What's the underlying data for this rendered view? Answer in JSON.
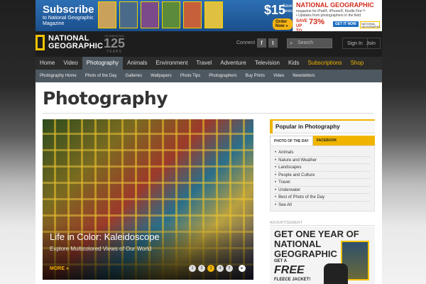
{
  "ad_left": {
    "title": "Subscribe",
    "text": "to National Geographic Magazine",
    "price": "$15",
    "price_note": "Save 79% off the newsstand price.",
    "button": "Order Now »",
    "cover_colors": [
      "#c9a15a",
      "#4a6a8a",
      "#7a4a8a",
      "#5a8a3a",
      "#c5603a",
      "#e0c040"
    ]
  },
  "ad_right": {
    "title": "NATIONAL GEOGRAPHIC",
    "line1": "magazine for iPad®, iPhone®, Kindle Fire™",
    "line2": "• Updates from photographers in the field",
    "save_label": "SAVE UP TO",
    "save_pct": "73%",
    "button": "GET IT NOW",
    "mini_logo": "NATIONAL GEOGRAPHIC"
  },
  "header": {
    "logo_line1": "NATIONAL",
    "logo_line2": "GEOGRAPHIC",
    "anniv_top": "CELEBRATING",
    "anniv_num": "125",
    "anniv_bottom": "YEARS",
    "connect": "Connect",
    "facebook": "f",
    "twitter": "t",
    "search_placeholder": "Search",
    "sign_in": "Sign In",
    "join": "Join"
  },
  "nav": [
    {
      "label": "Home",
      "key": "home"
    },
    {
      "label": "Video",
      "key": "video"
    },
    {
      "label": "Photography",
      "key": "photography",
      "active": true
    },
    {
      "label": "Animals",
      "key": "animals"
    },
    {
      "label": "Environment",
      "key": "environment"
    },
    {
      "label": "Travel",
      "key": "travel"
    },
    {
      "label": "Adventure",
      "key": "adventure"
    },
    {
      "label": "Television",
      "key": "television"
    },
    {
      "label": "Kids",
      "key": "kids"
    },
    {
      "label": "Subscriptions",
      "key": "subscriptions",
      "gold": true
    },
    {
      "label": "Shop",
      "key": "shop",
      "gold": true
    }
  ],
  "subnav": [
    "Photography Home",
    "Photo of the Day",
    "Galleries",
    "Wallpapers",
    "Photo Tips",
    "Photographers",
    "Buy Prints",
    "Video",
    "Newsletters"
  ],
  "page": {
    "title": "Photography"
  },
  "hero": {
    "title": "Life in Color: Kaleidoscope",
    "subtitle": "Explore Multicolored Views of Our World",
    "more": "MORE »",
    "dots": [
      "1",
      "2",
      "3",
      "4",
      "5"
    ],
    "active_dot": 2,
    "next": "►"
  },
  "popular": {
    "heading": "Popular in Photography",
    "tab_active": "PHOTO OF THE DAY",
    "tab_inactive": "FACEBOOK",
    "items": [
      "Animals",
      "Nature and Weather",
      "Landscapes",
      "People and Culture",
      "Travel",
      "Underwater",
      "Best of Photo of the Day",
      "See All"
    ]
  },
  "promo": {
    "label": "ADVERTISEMENT",
    "line1": "GET ONE YEAR OF",
    "line2": "NATIONAL",
    "line3": "GEOGRAPHIC",
    "line4": "GET A",
    "line5": "FREE",
    "line6": "FLEECE JACKET!"
  },
  "colors": {
    "accent": "#f0b400",
    "nav_bg": "#2b2b2b",
    "subnav_bg": "#4e5860"
  }
}
